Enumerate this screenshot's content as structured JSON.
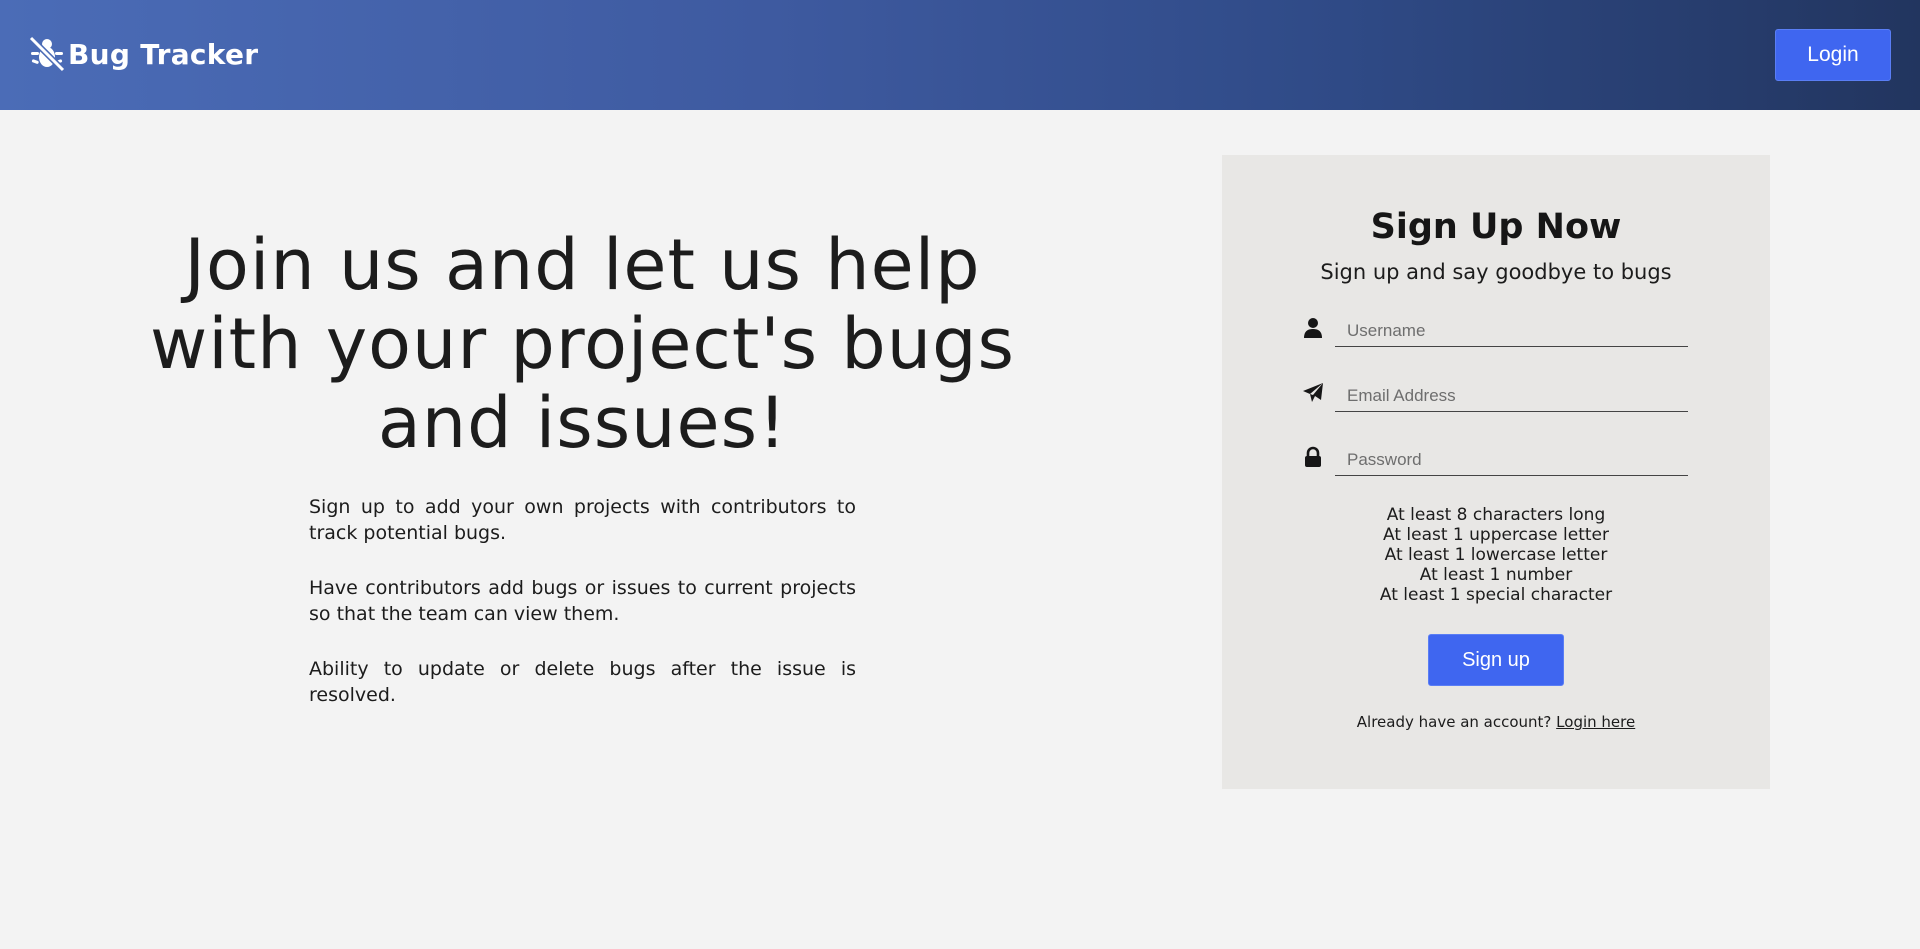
{
  "header": {
    "brand_name": "Bug Tracker",
    "brand_icon": "bug-slash-icon",
    "login_label": "Login",
    "gradient_start": "#4b6cb7",
    "gradient_end": "#22355f"
  },
  "hero": {
    "title": "Join us and let us help with your project's bugs and issues!",
    "features": [
      "Sign up to add your own projects with contributors to track potential bugs.",
      "Have contributors add bugs or issues to current projects so that the team can view them.",
      "Ability to update or delete bugs after the issue is resolved."
    ]
  },
  "signup": {
    "title": "Sign Up Now",
    "subtitle": "Sign up and say goodbye to bugs",
    "fields": [
      {
        "icon": "user-icon",
        "placeholder": "Username",
        "value": ""
      },
      {
        "icon": "paper-plane-icon",
        "placeholder": "Email Address",
        "value": ""
      },
      {
        "icon": "lock-icon",
        "placeholder": "Password",
        "value": ""
      }
    ],
    "password_rules": [
      "At least 8 characters long",
      "At least 1 uppercase letter",
      "At least 1 lowercase letter",
      "At least 1 number",
      "At least 1 special character"
    ],
    "button_label": "Sign up",
    "login_prompt": "Already have an account?",
    "login_link": "Login here"
  },
  "colors": {
    "accent": "#3f66f0",
    "page_background": "#f3f3f3",
    "card_background": "#e8e7e5",
    "text": "#1c1c1c"
  }
}
